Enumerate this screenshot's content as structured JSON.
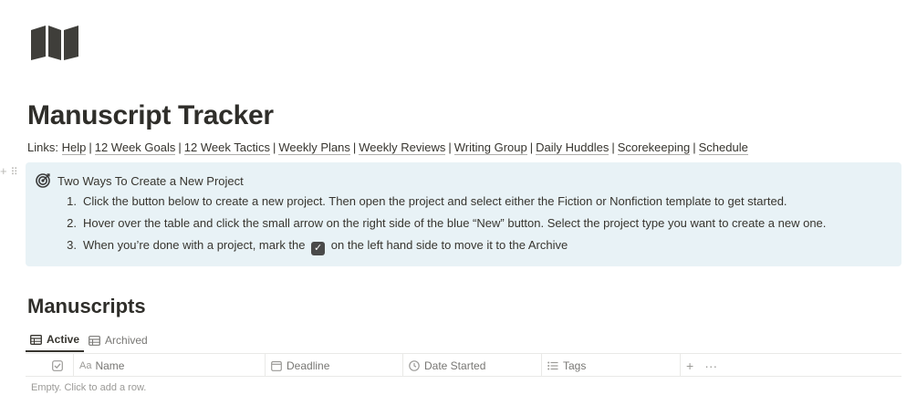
{
  "page": {
    "icon": "map-icon",
    "title": "Manuscript Tracker"
  },
  "links": {
    "prefix": "Links:",
    "separator": "|",
    "items": [
      "Help",
      "12 Week Goals",
      "12 Week Tactics",
      "Weekly Plans",
      "Weekly Reviews",
      "Writing Group",
      "Daily Huddles",
      "Scorekeeping",
      "Schedule"
    ]
  },
  "callout": {
    "icon": "target-icon",
    "title": "Two Ways To Create a New Project",
    "items": [
      {
        "num": "1.",
        "text": "Click the button below to create a new project. Then open the project and select either the Fiction or Nonfiction template to get started."
      },
      {
        "num": "2.",
        "text": "Hover over the table and click the small arrow on the right side of the blue “New” button. Select the project type you want to create a new one."
      },
      {
        "num": "3.",
        "text_before": "When you’re done with a project, mark the",
        "check": "✓",
        "text_after": "on the left hand side to move it to the Archive"
      }
    ]
  },
  "database": {
    "title": "Manuscripts",
    "tabs": [
      {
        "label": "Active",
        "icon": "table-icon",
        "active": true
      },
      {
        "label": "Archived",
        "icon": "table-icon",
        "active": false
      }
    ],
    "columns": [
      {
        "label": "Name",
        "icon": "text-icon",
        "icon_text": "Aa"
      },
      {
        "label": "Deadline",
        "icon": "calendar-icon"
      },
      {
        "label": "Date Started",
        "icon": "clock-icon"
      },
      {
        "label": "Tags",
        "icon": "list-icon"
      }
    ],
    "add_column": "+",
    "more": "···",
    "empty_text": "Empty. Click to add a row."
  },
  "block_handle": {
    "add": "+",
    "drag": "⠿"
  },
  "colors": {
    "callout_bg": "#e8f2f6",
    "text": "#37352f",
    "muted": "#787774",
    "border": "#e9e9e7"
  }
}
